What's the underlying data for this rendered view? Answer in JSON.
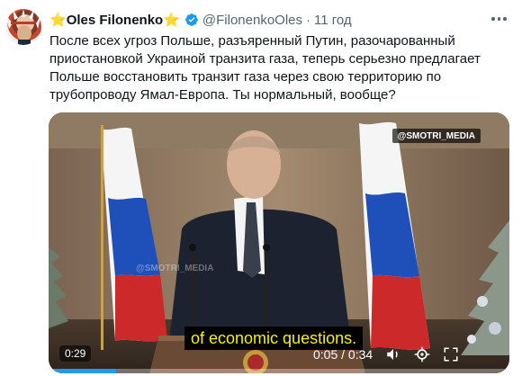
{
  "tweet": {
    "author_name": "Oles Filonenko",
    "author_star_left": "⭐",
    "author_star_right": "⭐",
    "handle": "@FilonenkoOles",
    "separator": "·",
    "time": "11 год",
    "text": "После всех угроз Польше, разъяренный Путин, разочарованный приостановкой Украиной транзита газа, теперь серьезно предлагает Польше восстановить транзит газа через свою территорию по трубопроводу Ямал-Европа. Ты нормальный, вообще?"
  },
  "video": {
    "watermark_top": "@SMOTRI_MEDIA",
    "watermark_mid": "@SMOTRI_MEDIA",
    "subtitle": "of economic questions.",
    "remaining": "0:29",
    "progress": "0:05 / 0:34"
  },
  "icons": {
    "more": "more-horizontal-icon",
    "verified": "verified-badge-icon",
    "volume": "volume-icon",
    "settings": "settings-gear-icon"
  },
  "colors": {
    "verified_blue": "#1d9bf0",
    "secondary_text": "#536471",
    "subtitle_yellow": "#f7f200",
    "star_gold": "#f4b400"
  }
}
